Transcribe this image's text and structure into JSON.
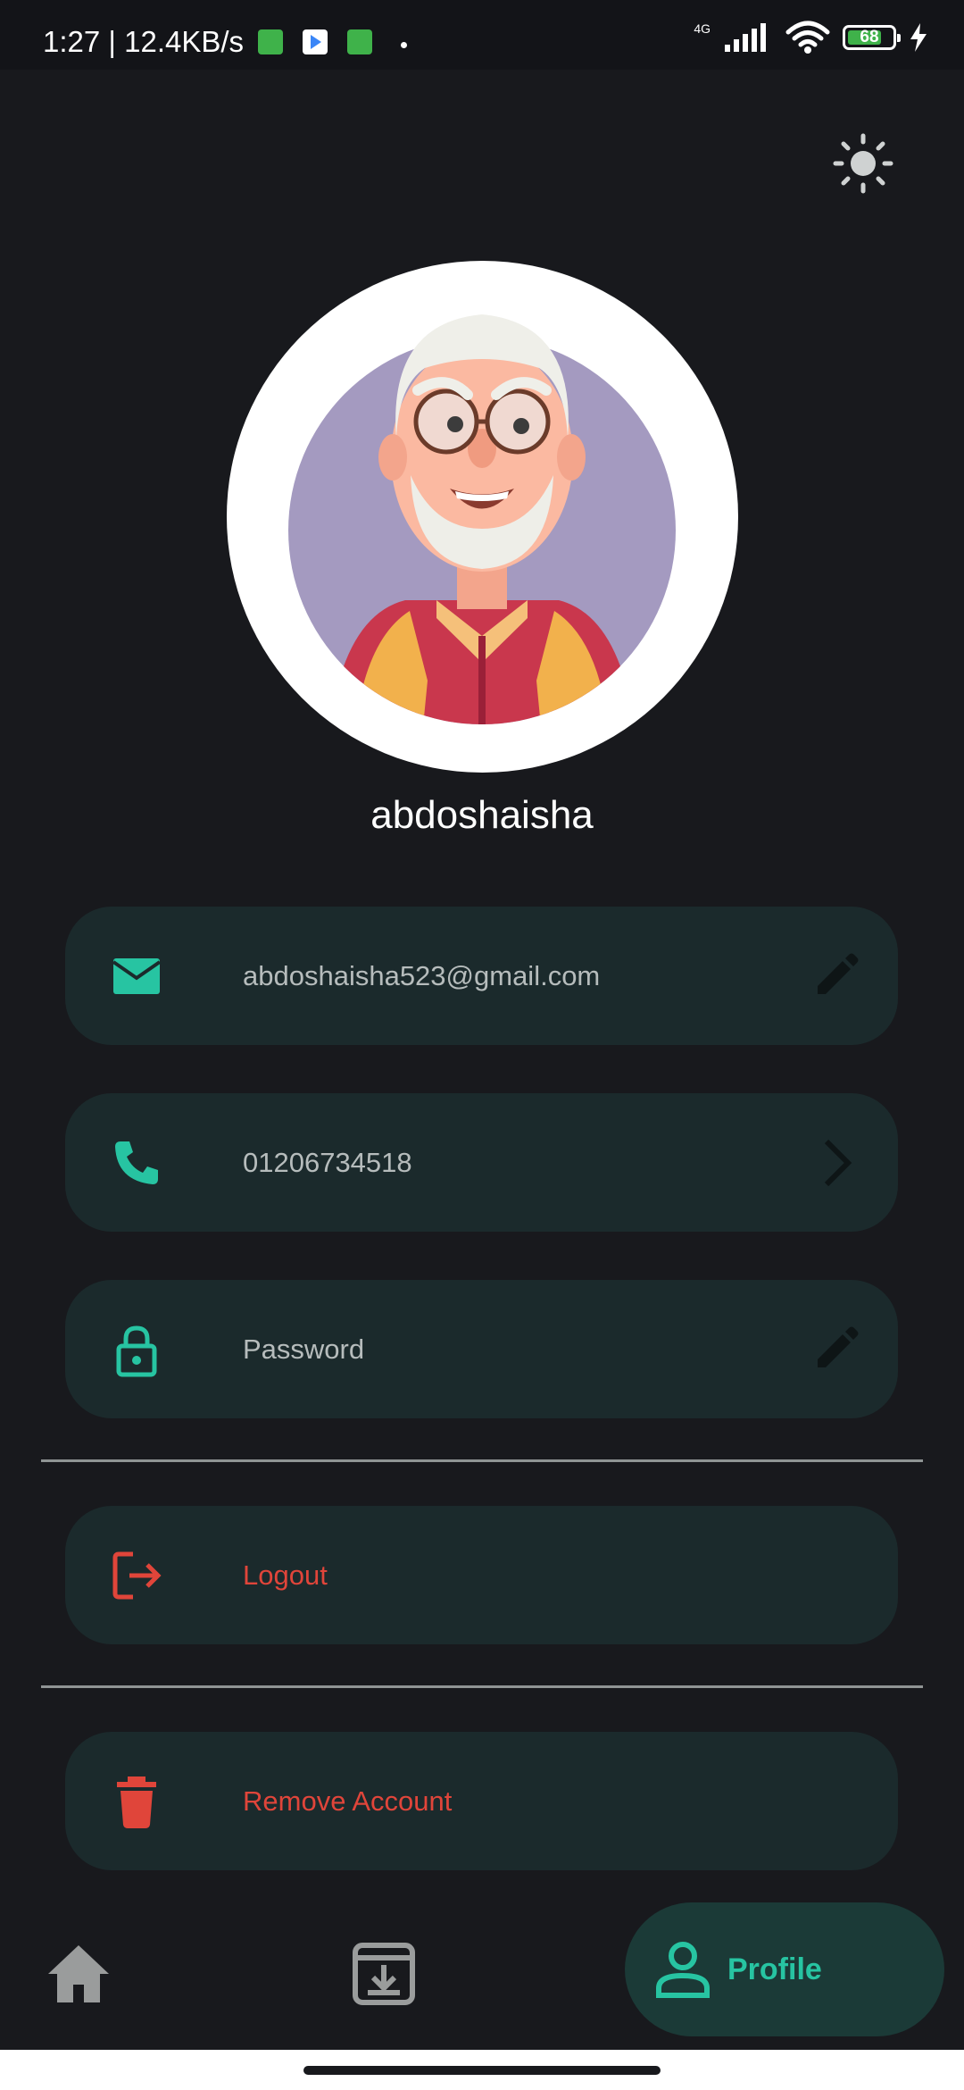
{
  "status_bar": {
    "time_speed": "1:27 | 12.4KB/s",
    "network": "4G",
    "battery_level": "68",
    "notification_icons": [
      "android-app-icon",
      "play-store-icon",
      "android-app-icon"
    ]
  },
  "theme_toggle": {
    "icon": "sun-icon"
  },
  "profile": {
    "avatar_icon": "avatar-old-man",
    "username": "abdoshaisha"
  },
  "cards": {
    "email": {
      "value": "abdoshaisha523@gmail.com",
      "icon": "mail-icon",
      "action_icon": "pencil-icon"
    },
    "phone": {
      "value": "01206734518",
      "icon": "phone-icon",
      "action_icon": "chevron-right-icon"
    },
    "password": {
      "value": "Password",
      "icon": "lock-icon",
      "action_icon": "pencil-icon"
    },
    "logout": {
      "value": "Logout",
      "icon": "logout-icon"
    },
    "remove": {
      "value": "Remove Account",
      "icon": "trash-icon"
    }
  },
  "bottom_nav": {
    "items": [
      {
        "icon": "home-icon",
        "active": false
      },
      {
        "icon": "archive-icon",
        "active": false
      },
      {
        "icon": "person-icon",
        "label": "Profile",
        "active": true
      }
    ]
  },
  "colors": {
    "background": "#18191d",
    "card": "#1b2a2c",
    "accent": "#27c4a2",
    "danger": "#e0453a",
    "text_muted": "#b6bcbc"
  }
}
